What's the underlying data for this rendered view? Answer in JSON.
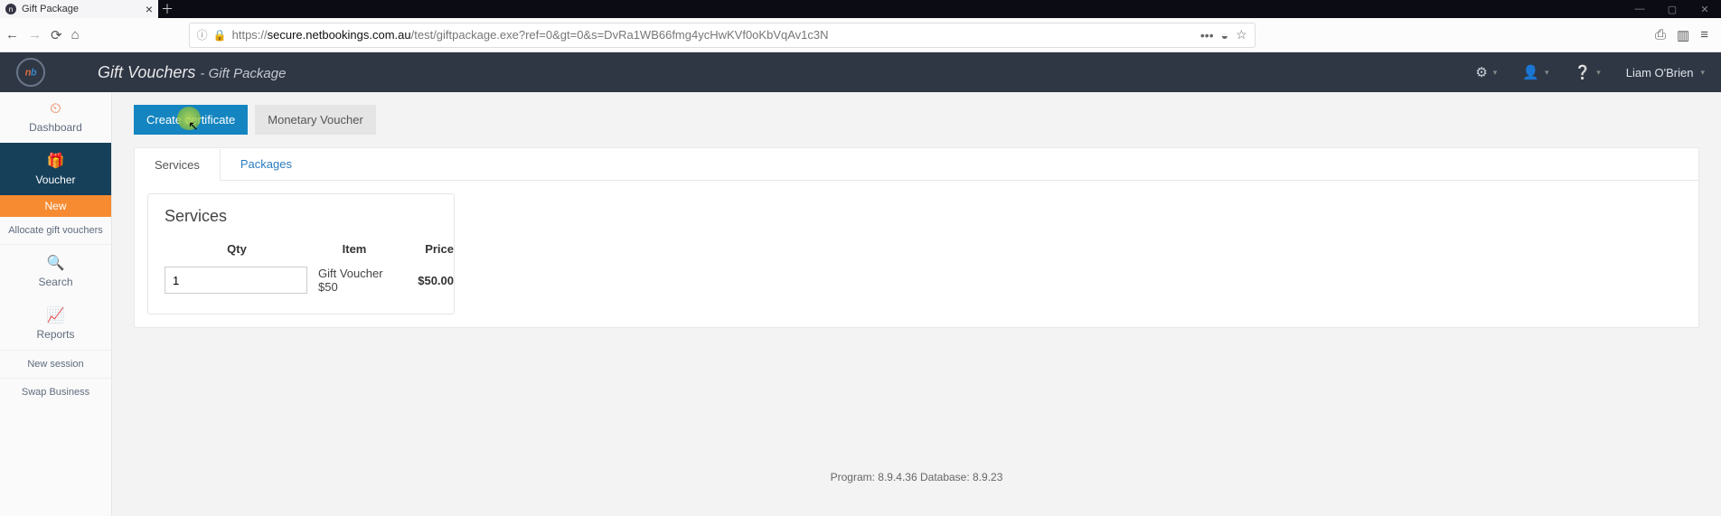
{
  "browser": {
    "tab_title": "Gift Package",
    "url_prefix": "https://",
    "url_domain": "secure.netbookings.com.au",
    "url_path": "/test/giftpackage.exe?ref=0&gt=0&s=DvRa1WB66fmg4ycHwKVf0oKbVqAv1c3N"
  },
  "header": {
    "title": "Gift Vouchers",
    "subtitle": "- Gift Package",
    "username": "Liam O'Brien"
  },
  "sidebar": {
    "items": [
      {
        "label": "Dashboard"
      },
      {
        "label": "Voucher"
      },
      {
        "label": "New"
      },
      {
        "label": "Allocate gift vouchers"
      },
      {
        "label": "Search"
      },
      {
        "label": "Reports"
      },
      {
        "label": "New session"
      },
      {
        "label": "Swap Business"
      }
    ]
  },
  "actions": {
    "create_certificate": "Create certificate",
    "monetary_voucher": "Monetary Voucher"
  },
  "tabs": {
    "services": "Services",
    "packages": "Packages"
  },
  "services_card": {
    "heading": "Services",
    "columns": {
      "qty": "Qty",
      "item": "Item",
      "price": "Price"
    },
    "rows": [
      {
        "qty": "1",
        "item": "Gift Voucher $50",
        "price": "$50.00"
      }
    ]
  },
  "footer": "Program: 8.9.4.36 Database: 8.9.23"
}
